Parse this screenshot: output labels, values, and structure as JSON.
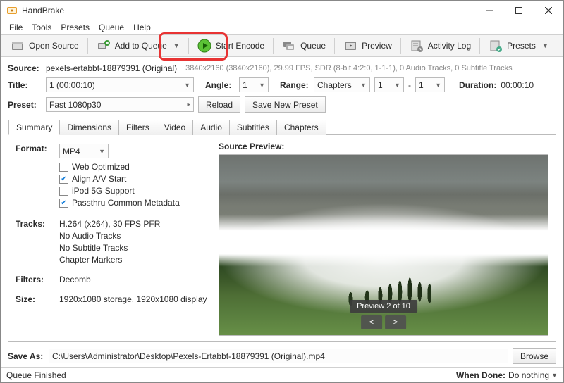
{
  "window": {
    "title": "HandBrake"
  },
  "menu": [
    "File",
    "Tools",
    "Presets",
    "Queue",
    "Help"
  ],
  "toolbar": {
    "open": "Open Source",
    "add_queue": "Add to Queue",
    "start_encode": "Start Encode",
    "queue": "Queue",
    "preview": "Preview",
    "activity": "Activity Log",
    "presets": "Presets"
  },
  "source": {
    "label": "Source:",
    "name": "pexels-ertabbt-18879391 (Original)",
    "meta": "3840x2160 (3840x2160), 29.99 FPS, SDR (8-bit 4:2:0, 1-1-1), 0 Audio Tracks, 0 Subtitle Tracks"
  },
  "title_row": {
    "title_label": "Title:",
    "title_value": "1  (00:00:10)",
    "angle_label": "Angle:",
    "angle_value": "1",
    "range_label": "Range:",
    "range_mode": "Chapters",
    "range_from": "1",
    "range_sep": "-",
    "range_to": "1",
    "duration_label": "Duration:",
    "duration_value": "00:00:10"
  },
  "preset_row": {
    "label": "Preset:",
    "value": "Fast 1080p30",
    "reload": "Reload",
    "save": "Save New Preset"
  },
  "tabs": [
    "Summary",
    "Dimensions",
    "Filters",
    "Video",
    "Audio",
    "Subtitles",
    "Chapters"
  ],
  "summary": {
    "format_label": "Format:",
    "format_value": "MP4",
    "checks": [
      {
        "label": "Web Optimized",
        "checked": false
      },
      {
        "label": "Align A/V Start",
        "checked": true
      },
      {
        "label": "iPod 5G Support",
        "checked": false
      },
      {
        "label": "Passthru Common Metadata",
        "checked": true
      }
    ],
    "tracks_label": "Tracks:",
    "tracks": [
      "H.264 (x264), 30 FPS PFR",
      "No Audio Tracks",
      "No Subtitle Tracks",
      "Chapter Markers"
    ],
    "filters_label": "Filters:",
    "filters_value": "Decomb",
    "size_label": "Size:",
    "size_value": "1920x1080 storage, 1920x1080 display",
    "preview_label": "Source Preview:",
    "preview_counter": "Preview 2 of 10",
    "prev": "<",
    "next": ">"
  },
  "save": {
    "label": "Save As:",
    "path": "C:\\Users\\Administrator\\Desktop\\Pexels-Ertabbt-18879391 (Original).mp4",
    "browse": "Browse"
  },
  "status": {
    "left": "Queue Finished",
    "done_label": "When Done:",
    "done_value": "Do nothing"
  }
}
